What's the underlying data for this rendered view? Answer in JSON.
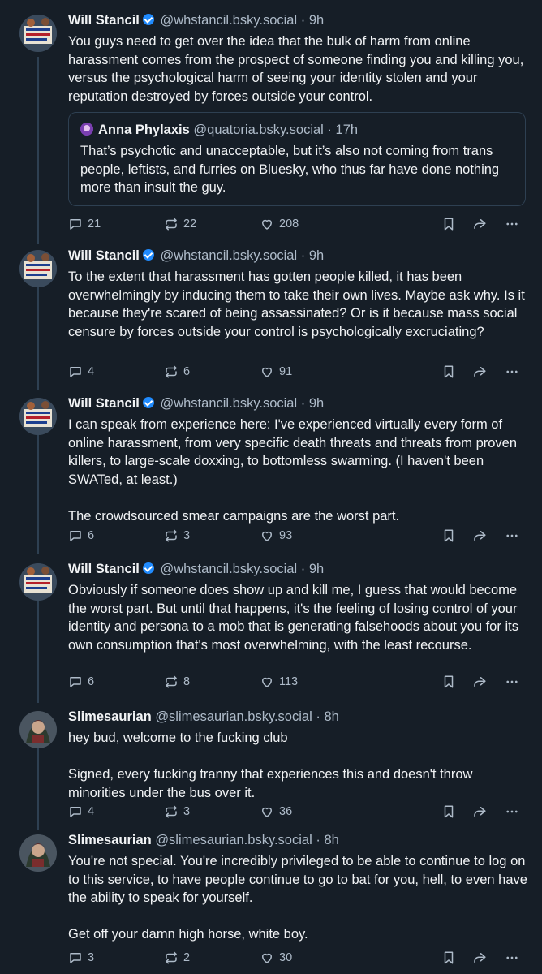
{
  "posts": [
    {
      "author": "Will Stancil",
      "verified": true,
      "handle": "@whstancil.bsky.social",
      "time": "9h",
      "text": "You guys need to get over the idea that the bulk of harm from online harassment comes from the prospect of someone finding you and killing you, versus the psychological harm of seeing your identity stolen and your reputation destroyed by forces outside your control.",
      "quote": {
        "author": "Anna Phylaxis",
        "handle": "@quatoria.bsky.social",
        "time": "17h",
        "text": "That’s psychotic and unacceptable, but it’s also not coming from trans people, leftists, and furries on Bluesky, who thus far have done nothing more than insult the guy."
      },
      "replies": "21",
      "reposts": "22",
      "likes": "208"
    },
    {
      "author": "Will Stancil",
      "verified": true,
      "handle": "@whstancil.bsky.social",
      "time": "9h",
      "text": "To the extent that harassment has gotten people killed, it has been overwhelmingly by inducing them to take their own lives. Maybe ask why. Is it because they're scared of being assassinated? Or is it because mass social censure by forces outside your control is psychologically excruciating?",
      "replies": "4",
      "reposts": "6",
      "likes": "91"
    },
    {
      "author": "Will Stancil",
      "verified": true,
      "handle": "@whstancil.bsky.social",
      "time": "9h",
      "text": "I can speak from experience here: I've experienced virtually every form of online harassment, from very specific death threats and threats from proven killers, to large-scale doxxing, to bottomless swarming. (I haven't been SWATed, at least.)\n\nThe crowdsourced smear campaigns are the worst part.",
      "replies": "6",
      "reposts": "3",
      "likes": "93"
    },
    {
      "author": "Will Stancil",
      "verified": true,
      "handle": "@whstancil.bsky.social",
      "time": "9h",
      "text": "Obviously if someone does show up and kill me, I guess that would become the worst part. But until that happens, it's the feeling of losing control of your identity and persona to a mob that is generating falsehoods about you for its own consumption that's most overwhelming, with the least recourse.",
      "replies": "6",
      "reposts": "8",
      "likes": "113"
    },
    {
      "author": "Slimesaurian",
      "verified": false,
      "handle": "@slimesaurian.bsky.social",
      "time": "8h",
      "text": "hey bud, welcome to the fucking club\n\nSigned, every fucking tranny that experiences this and doesn't throw minorities under the bus over it.",
      "replies": "4",
      "reposts": "3",
      "likes": "36"
    },
    {
      "author": "Slimesaurian",
      "verified": false,
      "handle": "@slimesaurian.bsky.social",
      "time": "8h",
      "text": "You're not special. You're incredibly privileged to be able to continue to log on to this service, to have people continue to go to bat for you, hell, to even have the ability to speak for yourself.\n\nGet off your damn high horse, white boy.",
      "replies": "3",
      "reposts": "2",
      "likes": "30"
    }
  ],
  "separator": "·",
  "colors": {
    "background": "#161e27",
    "text": "#f1f3f5",
    "muted": "#aebbc9",
    "verified": "#208bfe",
    "thread_line": "#2e4052"
  }
}
